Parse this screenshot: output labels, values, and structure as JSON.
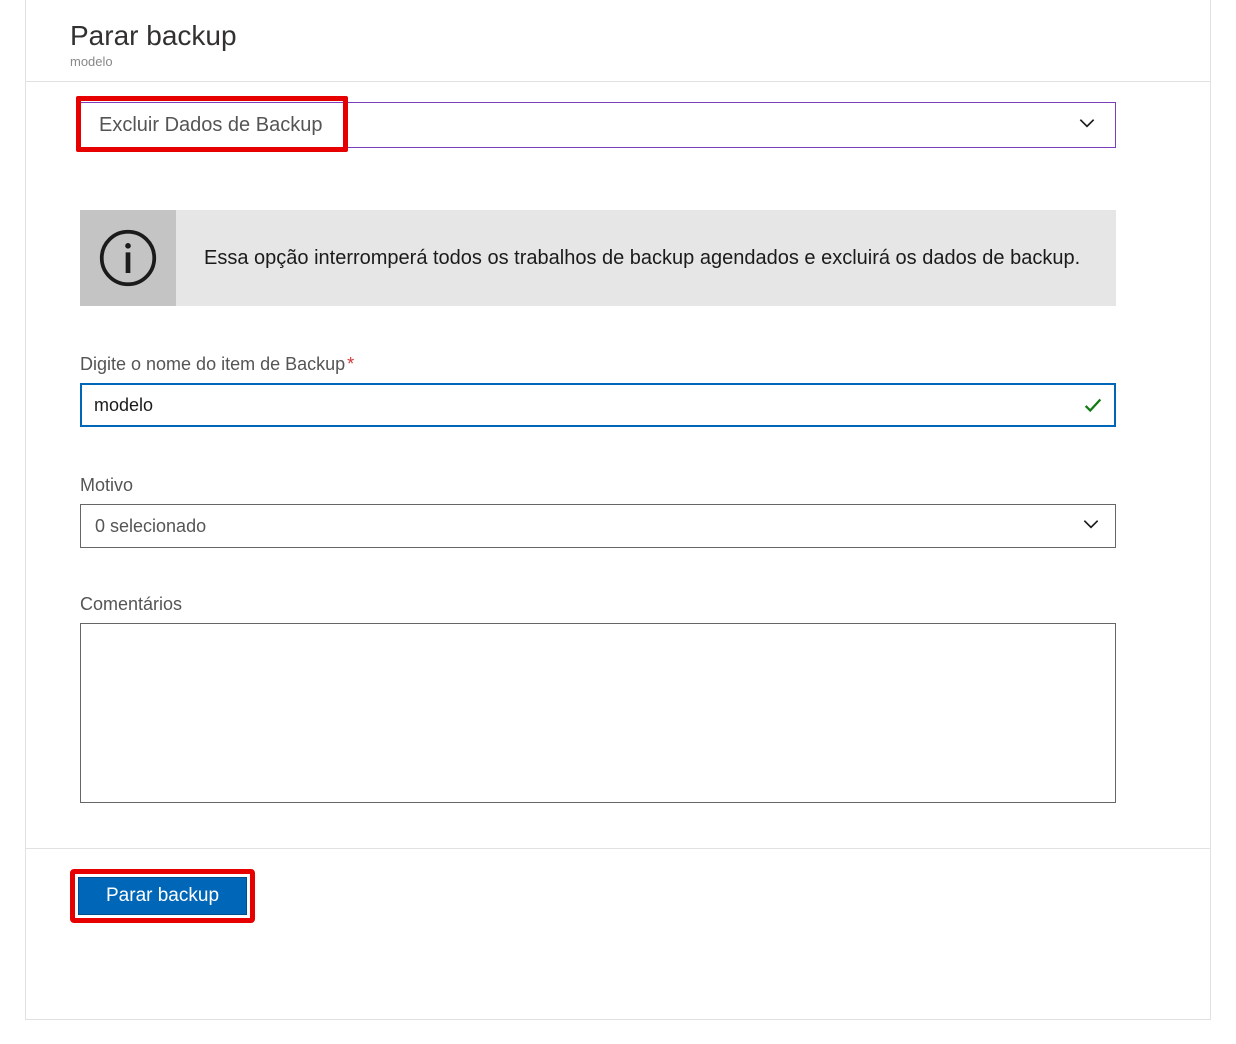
{
  "header": {
    "title": "Parar backup",
    "subtitle": "modelo"
  },
  "action_dropdown": {
    "selected": "Excluir Dados de Backup"
  },
  "info_banner": {
    "text": "Essa opção interromperá todos os trabalhos de backup agendados e excluirá os dados de backup."
  },
  "fields": {
    "item_name": {
      "label": "Digite o nome do item de Backup",
      "value": "modelo"
    },
    "reason": {
      "label": "Motivo",
      "selected": "0 selecionado"
    },
    "comments": {
      "label": "Comentários",
      "value": ""
    }
  },
  "buttons": {
    "stop": "Parar backup"
  }
}
